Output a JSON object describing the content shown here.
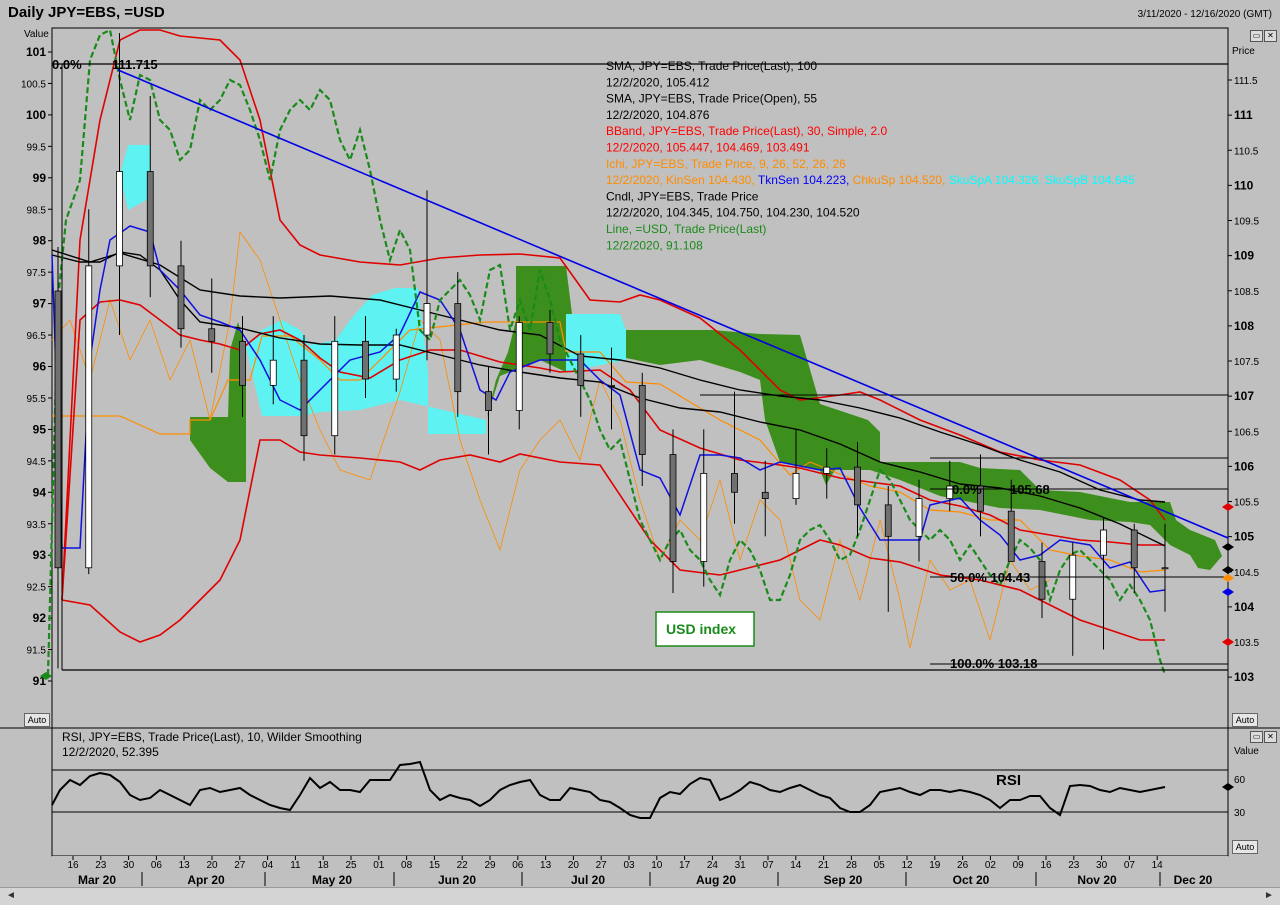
{
  "header": {
    "title": "Daily JPY=EBS, =USD",
    "date_range": "3/11/2020 - 12/16/2020 (GMT)",
    "auto_label": "Auto",
    "left_axis_title": "Value",
    "right_axis_title": "Price",
    "rsi_axis_title": "Value"
  },
  "legend": [
    {
      "text": "SMA, JPY=EBS, Trade Price(Last),  100",
      "color": "#000000"
    },
    {
      "text": "12/2/2020, 105.412",
      "color": "#000000"
    },
    {
      "text": "SMA, JPY=EBS, Trade Price(Open),  55",
      "color": "#000000"
    },
    {
      "text": "12/2/2020, 104.876",
      "color": "#000000"
    },
    {
      "text": "BBand, JPY=EBS, Trade Price(Last),  30, Simple, 2.0",
      "color": "#ff0000"
    },
    {
      "text": "12/2/2020, 105.447, 104.469, 103.491",
      "color": "#ff0000"
    },
    {
      "text": "Ichi, JPY=EBS, Trade Price,  9, 26, 52, 26, 26",
      "color": "#ff8c00"
    }
  ],
  "legend_ichi_values": [
    {
      "text": "12/2/2020, KinSen 104.430, ",
      "color": "#ff8c00"
    },
    {
      "text": "TknSen 104.223, ",
      "color": "#0000ff"
    },
    {
      "text": "ChkuSp 104.520, ",
      "color": "#ff8c00"
    },
    {
      "text": "SkuSpA 104.326, ",
      "color": "#00ffff"
    },
    {
      "text": "SkuSpB 104.645",
      "color": "#00ffff"
    }
  ],
  "legend_tail": [
    {
      "text": "Cndl, JPY=EBS, Trade Price",
      "color": "#000000"
    },
    {
      "text": "12/2/2020, 104.345, 104.750, 104.230, 104.520",
      "color": "#000000"
    },
    {
      "text": "Line, =USD, Trade Price(Last)",
      "color": "#1a8a1a"
    },
    {
      "text": "12/2/2020, 91.108",
      "color": "#1a8a1a"
    }
  ],
  "annotations": {
    "fib_top_pct": "0.0%",
    "fib_top_val": "111.715",
    "fib2_pct": "0.0%",
    "fib2_val": "105.68",
    "fib50": "50.0%   104.43",
    "fib100": "100.0% 103.18",
    "usd_box": "USD index",
    "rsi_label": "RSI"
  },
  "rsi_legend": [
    "RSI, JPY=EBS, Trade Price(Last),  10, Wilder Smoothing",
    "12/2/2020, 52.395"
  ],
  "chart_data": {
    "type": "line",
    "title": "Daily JPY=EBS, =USD",
    "left_axis": {
      "title": "Value",
      "ticks": [
        "101",
        "100.5",
        "100",
        "99.5",
        "99",
        "98.5",
        "98",
        "97.5",
        "97",
        "96.5",
        "96",
        "95.5",
        "95",
        "94.5",
        "94",
        "93.5",
        "93",
        "92.5",
        "92",
        "91.5",
        "91"
      ],
      "range": [
        91,
        101
      ]
    },
    "right_axis": {
      "title": "Price",
      "ticks": [
        "111.5",
        "111",
        "110.5",
        "110",
        "109.5",
        "109",
        "108.5",
        "108",
        "107.5",
        "107",
        "106.5",
        "106",
        "105.5",
        "105",
        "104.5",
        "104",
        "103.5",
        "103"
      ],
      "range": [
        103,
        111.5
      ]
    },
    "rsi_axis": {
      "title": "Value",
      "ticks": [
        "60",
        "30"
      ]
    },
    "x_day_ticks": [
      "16",
      "23",
      "30",
      "06",
      "13",
      "20",
      "27",
      "04",
      "11",
      "18",
      "25",
      "01",
      "08",
      "15",
      "22",
      "29",
      "06",
      "13",
      "20",
      "27",
      "03",
      "10",
      "17",
      "24",
      "31",
      "07",
      "14",
      "21",
      "28",
      "05",
      "12",
      "19",
      "26",
      "02",
      "09",
      "16",
      "23",
      "30",
      "07",
      "14"
    ],
    "x_month_labels": [
      "Mar 20",
      "Apr 20",
      "May 20",
      "Jun 20",
      "Jul 20",
      "Aug 20",
      "Sep 20",
      "Oct 20",
      "Nov 20",
      "Dec 20"
    ],
    "series": [
      {
        "name": "SMA, JPY=EBS, Trade Price(Last),  100",
        "color": "#000000",
        "points": [
          [
            0,
            97.9
          ],
          [
            4,
            97.8
          ],
          [
            8,
            97.5
          ],
          [
            12,
            97.0
          ],
          [
            16,
            96.6
          ],
          [
            20,
            96.3
          ],
          [
            24,
            96.3
          ],
          [
            28,
            96.1
          ],
          [
            32,
            95.6
          ],
          [
            36,
            95.1
          ],
          [
            40,
            94.8
          ],
          [
            41,
            94.6
          ]
        ]
      },
      {
        "name": "SMA, JPY=EBS, Trade Price(Open),  55",
        "color": "#000000",
        "points": [
          [
            0,
            97.7
          ],
          [
            2,
            97.7
          ],
          [
            4,
            97.9
          ],
          [
            6,
            97.4
          ],
          [
            8,
            96.6
          ],
          [
            10,
            96.4
          ],
          [
            13,
            96.3
          ],
          [
            16,
            96.0
          ],
          [
            18,
            95.8
          ],
          [
            20,
            95.4
          ],
          [
            23,
            95.1
          ],
          [
            26,
            94.8
          ],
          [
            28,
            94.5
          ],
          [
            30,
            94.3
          ],
          [
            33,
            94.1
          ],
          [
            36,
            93.6
          ],
          [
            39,
            93.3
          ],
          [
            41,
            93.0
          ]
        ]
      },
      {
        "name": "=USD, Trade Price(Last)",
        "color": "#1a8a1a",
        "points": [
          [
            0,
            97.0
          ],
          [
            2,
            101.4
          ],
          [
            4,
            99.5
          ],
          [
            6,
            100.5
          ],
          [
            8,
            99.3
          ],
          [
            10,
            100.4
          ],
          [
            12,
            98.9
          ],
          [
            14,
            100.2
          ],
          [
            16,
            99.1
          ],
          [
            18,
            98.6
          ],
          [
            20,
            97.0
          ],
          [
            22,
            97.2
          ],
          [
            23,
            96.1
          ],
          [
            25,
            95.3
          ],
          [
            27,
            93.2
          ],
          [
            29,
            92.2
          ],
          [
            31,
            92.3
          ],
          [
            33,
            93.1
          ],
          [
            35,
            93.7
          ],
          [
            37,
            93.5
          ],
          [
            39,
            92.2
          ],
          [
            40,
            91.1
          ]
        ]
      },
      {
        "name": "BBand upper, JPY=EBS",
        "color": "#ff0000",
        "points": [
          [
            2,
            100.4
          ],
          [
            5,
            101.6
          ],
          [
            8,
            99.6
          ],
          [
            10,
            98.0
          ],
          [
            12,
            97.6
          ],
          [
            14,
            97.7
          ],
          [
            16,
            97.2
          ],
          [
            18,
            97.0
          ],
          [
            20,
            96.1
          ],
          [
            22,
            96.4
          ],
          [
            24,
            95.9
          ],
          [
            26,
            95.1
          ],
          [
            28,
            95.3
          ],
          [
            30,
            94.5
          ],
          [
            32,
            94.4
          ],
          [
            34,
            94.1
          ],
          [
            36,
            94.6
          ],
          [
            38,
            94.3
          ],
          [
            40,
            93.9
          ]
        ]
      },
      {
        "name": "BBand middle, JPY=EBS",
        "color": "#ff0000",
        "points": [
          [
            2,
            97.4
          ],
          [
            5,
            97.0
          ],
          [
            8,
            96.3
          ],
          [
            10,
            96.5
          ],
          [
            12,
            96.5
          ],
          [
            14,
            96.4
          ],
          [
            16,
            96.2
          ],
          [
            18,
            95.7
          ],
          [
            20,
            95.4
          ],
          [
            22,
            95.3
          ],
          [
            24,
            94.7
          ],
          [
            26,
            94.2
          ],
          [
            28,
            93.9
          ],
          [
            30,
            93.6
          ],
          [
            32,
            93.1
          ],
          [
            34,
            92.7
          ],
          [
            36,
            92.9
          ],
          [
            38,
            92.9
          ],
          [
            40,
            92.6
          ]
        ]
      },
      {
        "name": "BBand lower, JPY=EBS",
        "color": "#ff0000",
        "points": [
          [
            2,
            92.6
          ],
          [
            5,
            91.6
          ],
          [
            6,
            91.9
          ],
          [
            8,
            94.0
          ],
          [
            10,
            94.5
          ],
          [
            12,
            95.0
          ],
          [
            14,
            95.5
          ],
          [
            16,
            94.5
          ],
          [
            18,
            94.4
          ],
          [
            20,
            93.0
          ],
          [
            22,
            92.9
          ],
          [
            24,
            92.8
          ],
          [
            26,
            93.0
          ],
          [
            28,
            92.7
          ],
          [
            30,
            92.1
          ],
          [
            32,
            91.9
          ],
          [
            34,
            91.6
          ],
          [
            36,
            91.5
          ],
          [
            38,
            91.5
          ],
          [
            40,
            91.6
          ]
        ]
      },
      {
        "name": "RSI, JPY=EBS, Trade Price(Last),  10, Wilder Smoothing",
        "color": "#000000",
        "points": [
          [
            0,
            28
          ],
          [
            2,
            55
          ],
          [
            4,
            58
          ],
          [
            6,
            40
          ],
          [
            8,
            37
          ],
          [
            10,
            47
          ],
          [
            12,
            36
          ],
          [
            14,
            57
          ],
          [
            16,
            47
          ],
          [
            18,
            62
          ],
          [
            20,
            39
          ],
          [
            22,
            47
          ],
          [
            24,
            27
          ],
          [
            26,
            38
          ],
          [
            28,
            58
          ],
          [
            30,
            43
          ],
          [
            32,
            42
          ],
          [
            34,
            32
          ],
          [
            36,
            45
          ],
          [
            38,
            44
          ],
          [
            40,
            53
          ],
          [
            41,
            52.4
          ]
        ]
      }
    ],
    "candles_ohlc": [
      [
        97.2,
        97.9,
        91.2,
        92.8
      ],
      [
        92.8,
        98.5,
        92.7,
        97.6
      ],
      [
        97.6,
        101.3,
        96.5,
        99.1
      ],
      [
        99.1,
        100.3,
        97.1,
        97.6
      ],
      [
        97.6,
        98.0,
        96.3,
        96.6
      ],
      [
        96.6,
        97.4,
        95.9,
        96.4
      ],
      [
        96.4,
        96.8,
        95.2,
        95.7
      ],
      [
        95.7,
        96.8,
        95.4,
        96.1
      ],
      [
        96.1,
        96.5,
        94.5,
        94.9
      ],
      [
        94.9,
        96.8,
        94.6,
        96.4
      ],
      [
        96.4,
        96.8,
        95.5,
        95.8
      ],
      [
        95.8,
        96.6,
        95.6,
        96.5
      ],
      [
        96.5,
        98.8,
        96.1,
        97.0
      ],
      [
        97.0,
        97.5,
        95.2,
        95.6
      ],
      [
        95.6,
        96.0,
        94.6,
        95.3
      ],
      [
        95.3,
        96.8,
        95.0,
        96.7
      ],
      [
        96.7,
        96.9,
        95.9,
        96.2
      ],
      [
        96.2,
        96.5,
        95.2,
        95.7
      ],
      [
        95.7,
        96.3,
        95.0,
        95.7
      ],
      [
        95.7,
        95.9,
        94.1,
        94.6
      ],
      [
        94.6,
        95.0,
        92.4,
        92.9
      ],
      [
        92.9,
        95.0,
        92.5,
        94.3
      ],
      [
        94.3,
        95.6,
        93.5,
        94.0
      ],
      [
        94.0,
        94.5,
        93.3,
        93.9
      ],
      [
        93.9,
        95.0,
        93.8,
        94.3
      ],
      [
        94.3,
        94.7,
        93.9,
        94.4
      ],
      [
        94.4,
        94.8,
        93.3,
        93.8
      ],
      [
        93.8,
        94.1,
        92.1,
        93.3
      ],
      [
        93.3,
        94.2,
        92.9,
        93.9
      ],
      [
        93.9,
        94.5,
        93.7,
        94.1
      ],
      [
        94.1,
        94.6,
        93.3,
        93.7
      ],
      [
        93.7,
        94.2,
        92.9,
        92.9
      ],
      [
        92.9,
        93.2,
        92.0,
        92.3
      ],
      [
        92.3,
        93.2,
        91.4,
        93.0
      ],
      [
        93.0,
        93.6,
        91.5,
        93.4
      ],
      [
        93.4,
        93.5,
        92.4,
        92.8
      ],
      [
        92.8,
        93.5,
        92.1,
        92.8
      ]
    ],
    "horizontal_levels": [
      111.715,
      106.5,
      106.0,
      105.68,
      104.43,
      103.18
    ],
    "ylim": [
      91,
      101
    ],
    "grid": false,
    "legend_position": "top-center"
  }
}
